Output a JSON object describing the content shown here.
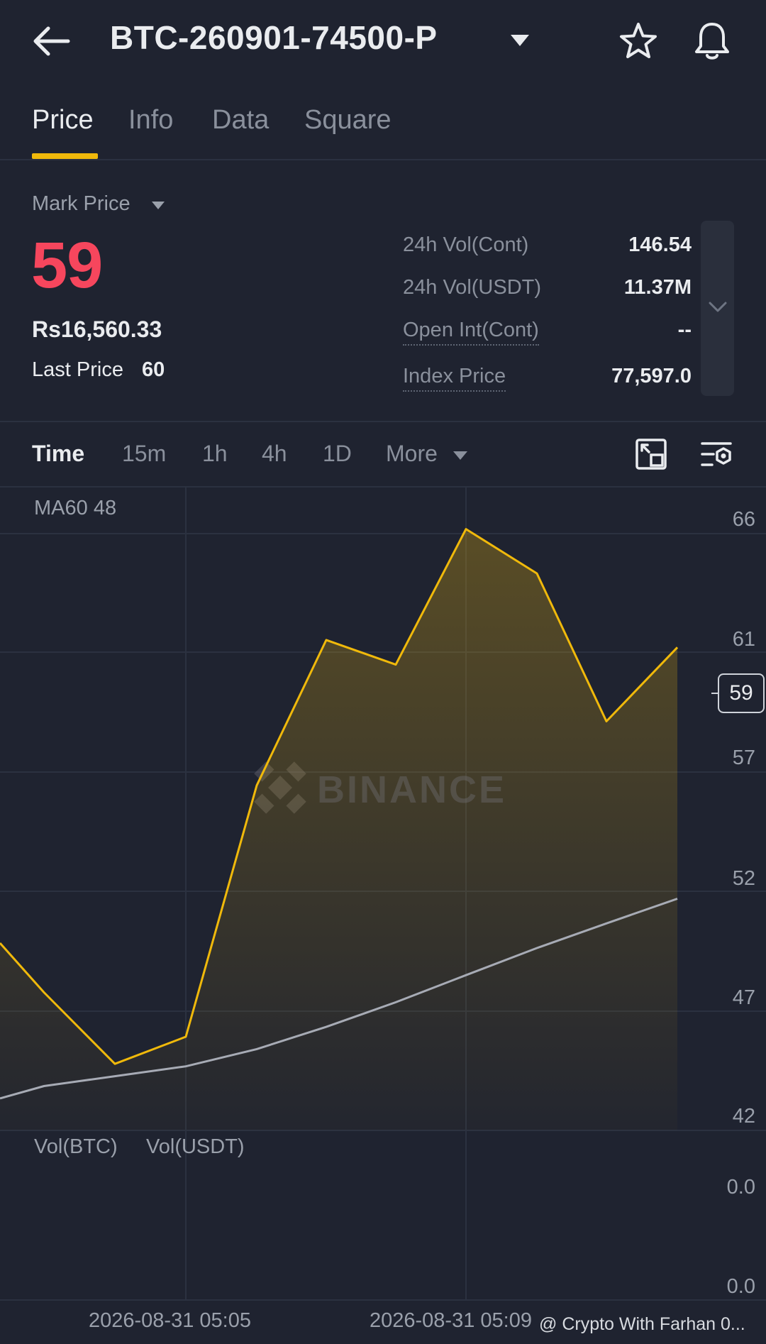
{
  "header": {
    "title": "BTC-260901-74500-P"
  },
  "tabs": [
    {
      "label": "Price"
    },
    {
      "label": "Info"
    },
    {
      "label": "Data"
    },
    {
      "label": "Square"
    }
  ],
  "price": {
    "mark_label": "Mark Price",
    "mark_value": "59",
    "fiat_value": "Rs16,560.33",
    "last_label": "Last Price",
    "last_value": "60"
  },
  "stats": [
    {
      "label": "24h Vol(Cont)",
      "value": "146.54"
    },
    {
      "label": "24h Vol(USDT)",
      "value": "11.37M"
    },
    {
      "label": "Open Int(Cont)",
      "value": "--"
    },
    {
      "label": "Index Price",
      "value": "77,597.0"
    }
  ],
  "timeframes": [
    {
      "label": "Time"
    },
    {
      "label": "15m"
    },
    {
      "label": "1h"
    },
    {
      "label": "4h"
    },
    {
      "label": "1D"
    },
    {
      "label": "More"
    }
  ],
  "chart": {
    "ma_label": "MA60 48",
    "current_value": "59",
    "vol_btc_label": "Vol(BTC)",
    "vol_usdt_label": "Vol(USDT)",
    "vol_ticks": [
      "0.0",
      "0.0"
    ],
    "watermark": "BINANCE",
    "credit": "@ Crypto With Farhan 0..."
  },
  "colors": {
    "background": "#1f2330",
    "accent": "#f0b90b",
    "negative": "#f6465d",
    "ma_line": "#a7abb5"
  },
  "chart_data": {
    "type": "area",
    "x": [
      "",
      "",
      "",
      "2026-08-31 05:05",
      "",
      "",
      "",
      "2026-08-31 05:09",
      "",
      "",
      ""
    ],
    "series": [
      {
        "values": [
          48.6,
          46.6,
          43.7,
          44.8,
          55.0,
          60.9,
          59.9,
          65.4,
          63.6,
          57.6,
          60.6
        ]
      },
      {
        "name": "MA60",
        "values": [
          42.3,
          42.8,
          43.2,
          43.6,
          44.3,
          45.2,
          46.2,
          47.3,
          48.4,
          49.4,
          50.4
        ]
      }
    ],
    "ylim": [
      41,
      67
    ],
    "y_ticks": [
      66,
      61,
      57,
      52,
      47,
      42
    ],
    "x_ticks": [
      "2026-08-31 05:05",
      "2026-08-31 05:09"
    ],
    "grid": true,
    "legend": "top-left"
  }
}
